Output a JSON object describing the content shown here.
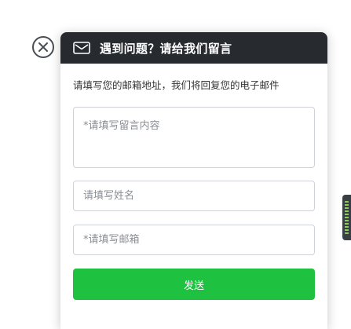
{
  "dialog": {
    "title": "遇到问题？请给我们留言",
    "description": "请填写您的邮箱地址，我们将回复您的电子邮件",
    "close_icon": "close-circle-icon",
    "header_icon": "mail-icon"
  },
  "form": {
    "message_placeholder": "*请填写留言内容",
    "name_placeholder": "请填写姓名",
    "email_placeholder": "*请填写邮箱",
    "send_label": "发送"
  },
  "colors": {
    "header_bg": "#272b30",
    "send_button": "#1ec240",
    "side_tab": "#3a3f45"
  },
  "side_tab": {
    "icon": "feedback-tab-icon"
  }
}
